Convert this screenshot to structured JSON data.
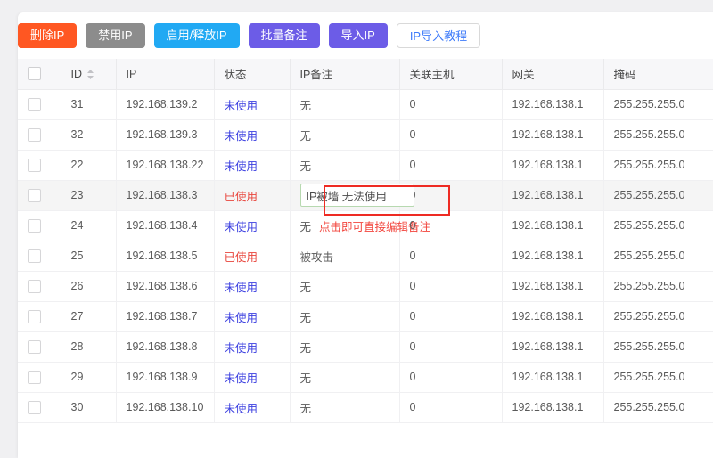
{
  "toolbar": {
    "buttons": [
      {
        "label": "删除IP",
        "name": "delete-ip-button",
        "color": "#ff5722"
      },
      {
        "label": "禁用IP",
        "name": "disable-ip-button",
        "color": "#8c8c8c"
      },
      {
        "label": "启用/释放IP",
        "name": "enable-release-ip-button",
        "color": "#21a9f3"
      },
      {
        "label": "批量备注",
        "name": "batch-note-button",
        "color": "#6c5ce7"
      },
      {
        "label": "导入IP",
        "name": "import-ip-button",
        "color": "#6c5ce7"
      },
      {
        "label": "IP导入教程",
        "name": "import-tutorial-button",
        "color": "#3e7bfa"
      }
    ]
  },
  "table": {
    "headers": {
      "select_all": "",
      "id": "ID",
      "ip": "IP",
      "state": "状态",
      "note": "IP备注",
      "host": "关联主机",
      "gateway": "网关",
      "mask": "掩码"
    },
    "rows": [
      {
        "id": "31",
        "ip": "192.168.139.2",
        "state": "未使用",
        "note": "无",
        "host": "0",
        "gateway": "192.168.138.1",
        "mask": "255.255.255.0"
      },
      {
        "id": "32",
        "ip": "192.168.139.3",
        "state": "未使用",
        "note": "无",
        "host": "0",
        "gateway": "192.168.138.1",
        "mask": "255.255.255.0"
      },
      {
        "id": "22",
        "ip": "192.168.138.22",
        "state": "未使用",
        "note": "无",
        "host": "0",
        "gateway": "192.168.138.1",
        "mask": "255.255.255.0"
      },
      {
        "id": "23",
        "ip": "192.168.138.3",
        "state": "已使用",
        "note": "IP被墙 无法使用",
        "host": "0",
        "gateway": "192.168.138.1",
        "mask": "255.255.255.0"
      },
      {
        "id": "24",
        "ip": "192.168.138.4",
        "state": "未使用",
        "note": "无",
        "host": "0",
        "gateway": "192.168.138.1",
        "mask": "255.255.255.0"
      },
      {
        "id": "25",
        "ip": "192.168.138.5",
        "state": "已使用",
        "note": "被攻击",
        "host": "0",
        "gateway": "192.168.138.1",
        "mask": "255.255.255.0"
      },
      {
        "id": "26",
        "ip": "192.168.138.6",
        "state": "未使用",
        "note": "无",
        "host": "0",
        "gateway": "192.168.138.1",
        "mask": "255.255.255.0"
      },
      {
        "id": "27",
        "ip": "192.168.138.7",
        "state": "未使用",
        "note": "无",
        "host": "0",
        "gateway": "192.168.138.1",
        "mask": "255.255.255.0"
      },
      {
        "id": "28",
        "ip": "192.168.138.8",
        "state": "未使用",
        "note": "无",
        "host": "0",
        "gateway": "192.168.138.1",
        "mask": "255.255.255.0"
      },
      {
        "id": "29",
        "ip": "192.168.138.9",
        "state": "未使用",
        "note": "无",
        "host": "0",
        "gateway": "192.168.138.1",
        "mask": "255.255.255.0"
      },
      {
        "id": "30",
        "ip": "192.168.138.10",
        "state": "未使用",
        "note": "无",
        "host": "0",
        "gateway": "192.168.138.1",
        "mask": "255.255.255.0"
      }
    ]
  },
  "annotation": {
    "hint_text": "点击即可直接编辑备注",
    "box_color": "#ee2b23",
    "text_color": "#f2453d"
  },
  "colors": {
    "state_used": "#e8453c",
    "state_unused": "#3b3fe0",
    "page_background": "#f0f0f2",
    "header_background": "#f7f7f9"
  },
  "icons": {
    "sort": "sort-icon",
    "checkbox": "checkbox-icon"
  }
}
